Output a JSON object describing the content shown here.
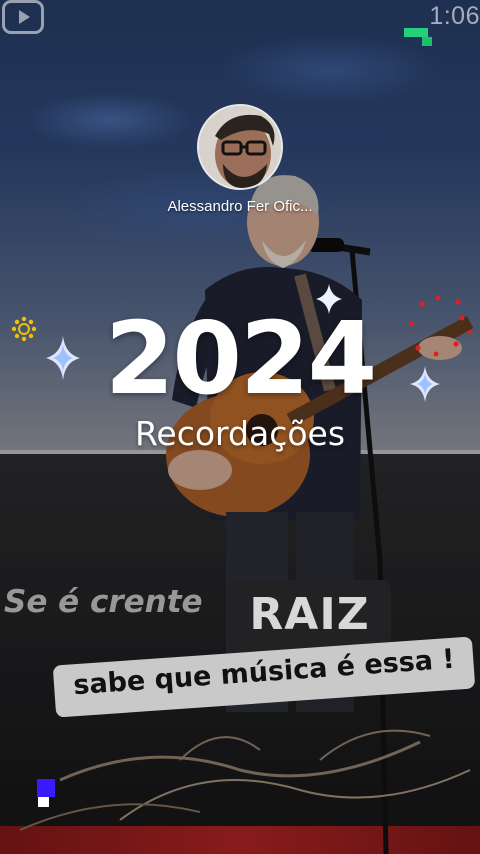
{
  "status_bar": {
    "time": "1:06"
  },
  "channel": {
    "name": "Alessandro Fer Ofic..."
  },
  "overlay": {
    "year": "2024",
    "subtitle": "Recordações",
    "phrase_part1": "Se é crente",
    "phrase_highlight": "RAIZ",
    "phrase_part2": "sabe que música é essa !"
  },
  "icons": {
    "app": "youtube-icon",
    "sparkle": "sparkle-icon",
    "sun": "sun-sticker-icon"
  },
  "colors": {
    "sparkle": "#dfe6ff",
    "sun": "#f2c300",
    "confetti": "#e02020",
    "highlight_box": "#222224",
    "strip_box": "#c9c9c9",
    "pixel_blue": "#3a1bff",
    "pixel_green": "#25d07a"
  }
}
